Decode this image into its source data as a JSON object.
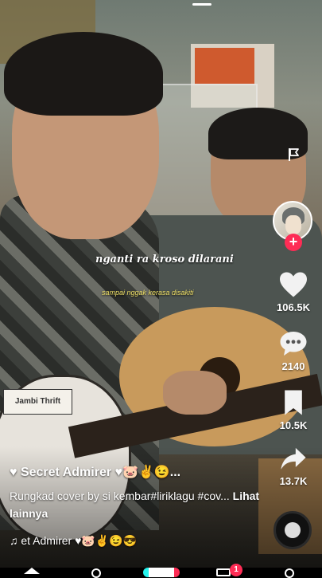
{
  "video": {
    "lyric_line1": "nganti ra kroso dilarani",
    "lyric_line2": "sampai nggak kerasa disakiti",
    "guitar_sticker": "Jambi Thrift"
  },
  "actions": {
    "likes": "106.5K",
    "comments": "2140",
    "saves": "10.5K",
    "shares": "13.7K"
  },
  "caption": {
    "username": "♥ Secret Admirer ♥🐷✌😉...",
    "description": "Rungkad cover by si kembar#liriklagu #cov...",
    "see_more": "Lihat lainnya",
    "sound": "♫  et Admirer ♥🐷✌😉😎"
  },
  "nav": {
    "inbox_badge": "1"
  },
  "colors": {
    "accent": "#fe2c55",
    "lyric_highlight": "#f2e36a"
  },
  "icons": [
    "flag-icon",
    "heart-icon",
    "comment-icon",
    "bookmark-icon",
    "share-icon",
    "music-note-icon",
    "music-disc-icon",
    "home-icon",
    "profile-icon"
  ]
}
